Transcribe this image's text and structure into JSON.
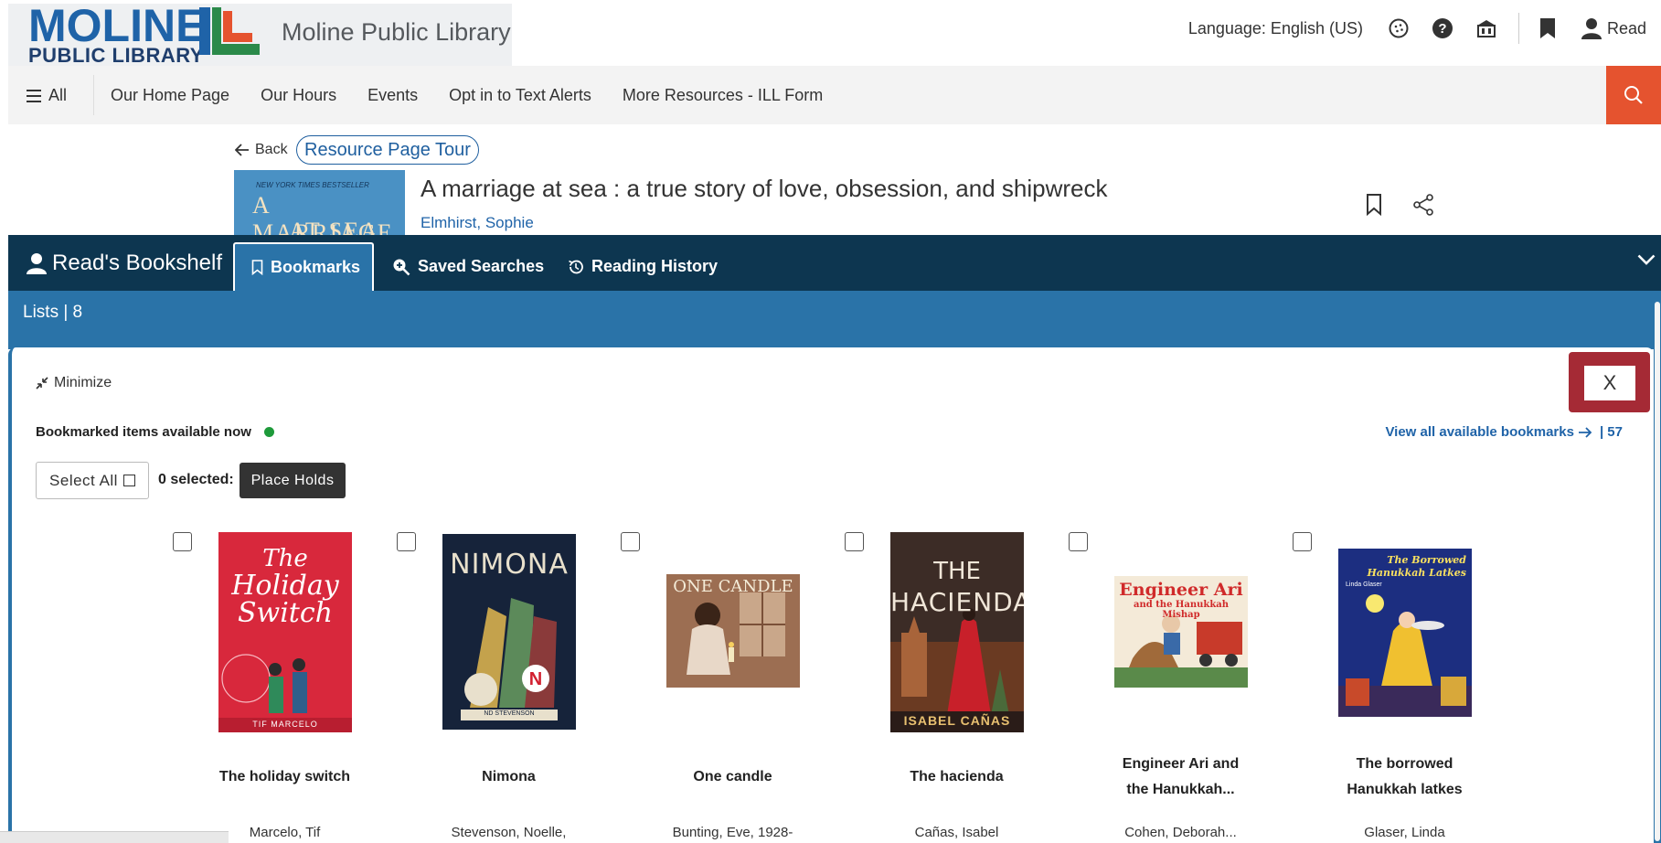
{
  "header": {
    "logo_main": "MOLINE",
    "logo_sub": "PUBLIC LIBRARY",
    "library_name": "Moline Public Library",
    "language_label": "Language: English (US)",
    "icons": [
      "accessibility-icon",
      "help-icon",
      "library-icon",
      "bookmark-icon",
      "user-icon"
    ],
    "user_label": "Read"
  },
  "nav": {
    "all_label": "All",
    "links": [
      "Our Home Page",
      "Our Hours",
      "Events",
      "Opt in to Text Alerts",
      "More Resources - ILL Form"
    ]
  },
  "resource": {
    "back_label": "Back",
    "tour_label": "Resource Page Tour",
    "cover_small_text": "NEW YORK TIMES BESTSELLER",
    "cover_line1": "A MARRIAGE",
    "cover_line2": "AT SEA",
    "title": "A marriage at sea : a true story of love, obsession, and shipwreck",
    "author": "Elmhirst, Sophie"
  },
  "bookshelf": {
    "title": "Read's Bookshelf",
    "tabs": [
      {
        "label": "Bookmarks",
        "active": true
      },
      {
        "label": "Saved Searches",
        "active": false
      },
      {
        "label": "Reading History",
        "active": false
      }
    ],
    "lists_label": "Lists | 8",
    "minimize_label": "Minimize",
    "close_label": "X",
    "available_label": "Bookmarked items available now",
    "view_all_label": "View all available bookmarks",
    "view_all_count": "| 57",
    "select_all_label": "Select All",
    "selected_count_label": "0 selected:",
    "place_holds_label": "Place Holds",
    "accent_color": "#2a73a8",
    "dark_color": "#0d3650"
  },
  "books": [
    {
      "title": "The holiday switch",
      "author": "Marcelo, Tif",
      "cover_lines": [
        "The",
        "Holiday",
        "Switch"
      ],
      "cover_author": "TIF MARCELO"
    },
    {
      "title": "Nimona",
      "author": "Stevenson, Noelle,",
      "cover_lines": [
        "NIMONA"
      ],
      "cover_author": "ND STEVENSON"
    },
    {
      "title": "One candle",
      "author": "Bunting, Eve, 1928-",
      "cover_lines": [
        "ONE CANDLE"
      ],
      "cover_author": ""
    },
    {
      "title": "The hacienda",
      "author": "Cañas, Isabel",
      "cover_lines": [
        "THE",
        "HACIENDA"
      ],
      "cover_author": "ISABEL CAÑAS"
    },
    {
      "title": "Engineer Ari and the Hanukkah...",
      "title_line1": "Engineer Ari and",
      "title_line2": "the Hanukkah...",
      "author": "Cohen, Deborah...",
      "cover_lines": [
        "Engineer Ari",
        "and the Hanukkah Mishap"
      ],
      "cover_author": ""
    },
    {
      "title": "The borrowed Hanukkah latkes",
      "title_line1": "The borrowed",
      "title_line2": "Hanukkah latkes",
      "author": "Glaser, Linda",
      "cover_lines": [
        "The Borrowed",
        "Hanukkah Latkes"
      ],
      "cover_author": "Linda Glaser"
    }
  ]
}
